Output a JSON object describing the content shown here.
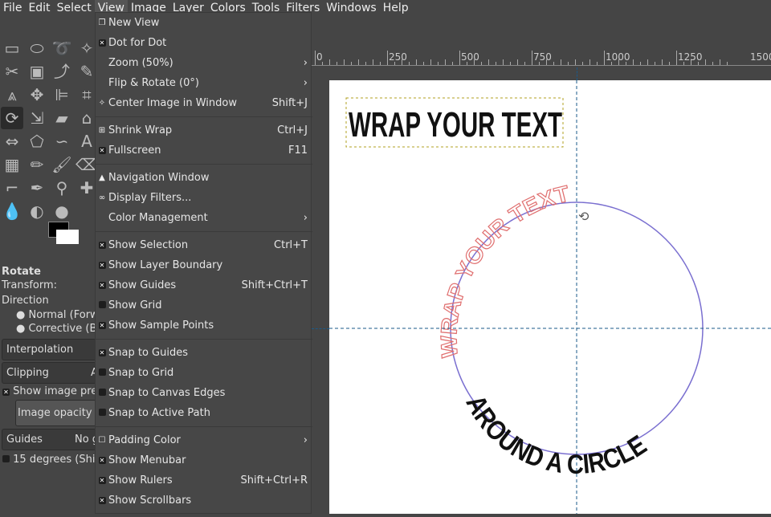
{
  "menubar": [
    "File",
    "Edit",
    "Select",
    "View",
    "Image",
    "Layer",
    "Colors",
    "Tools",
    "Filters",
    "Windows",
    "Help"
  ],
  "view_menu": {
    "groups": [
      [
        {
          "icon": "new-view",
          "label": "New View",
          "shortcut": ""
        },
        {
          "icon": "check",
          "checked": true,
          "label": "Dot for Dot",
          "shortcut": ""
        },
        {
          "icon": "",
          "label": "Zoom (50%)",
          "shortcut": "›"
        },
        {
          "icon": "",
          "label": "Flip & Rotate (0°)",
          "shortcut": "›"
        },
        {
          "icon": "center",
          "label": "Center Image in Window",
          "shortcut": "Shift+J"
        }
      ],
      [
        {
          "icon": "shrink",
          "label": "Shrink Wrap",
          "shortcut": "Ctrl+J"
        },
        {
          "icon": "check",
          "checked": true,
          "label": "Fullscreen",
          "shortcut": "F11"
        }
      ],
      [
        {
          "icon": "nav",
          "label": "Navigation Window",
          "shortcut": ""
        },
        {
          "icon": "glasses",
          "label": "Display Filters...",
          "shortcut": ""
        },
        {
          "icon": "",
          "label": "Color Management",
          "shortcut": "›"
        }
      ],
      [
        {
          "icon": "check",
          "checked": true,
          "label": "Show Selection",
          "shortcut": "Ctrl+T"
        },
        {
          "icon": "check",
          "checked": true,
          "label": "Show Layer Boundary",
          "shortcut": ""
        },
        {
          "icon": "check",
          "checked": true,
          "label": "Show Guides",
          "shortcut": "Shift+Ctrl+T"
        },
        {
          "icon": "check",
          "checked": false,
          "label": "Show Grid",
          "shortcut": ""
        },
        {
          "icon": "check",
          "checked": true,
          "label": "Show Sample Points",
          "shortcut": ""
        }
      ],
      [
        {
          "icon": "check",
          "checked": true,
          "label": "Snap to Guides",
          "shortcut": ""
        },
        {
          "icon": "check",
          "checked": false,
          "label": "Snap to Grid",
          "shortcut": ""
        },
        {
          "icon": "check",
          "checked": false,
          "label": "Snap to Canvas Edges",
          "shortcut": ""
        },
        {
          "icon": "check",
          "checked": false,
          "label": "Snap to Active Path",
          "shortcut": ""
        }
      ],
      [
        {
          "icon": "square",
          "label": "Padding Color",
          "shortcut": "›"
        },
        {
          "icon": "check",
          "checked": true,
          "label": "Show Menubar",
          "shortcut": ""
        },
        {
          "icon": "check",
          "checked": true,
          "label": "Show Rulers",
          "shortcut": "Shift+Ctrl+R"
        },
        {
          "icon": "check",
          "checked": true,
          "label": "Show Scrollbars",
          "shortcut": ""
        }
      ]
    ]
  },
  "tool_options": {
    "title": "Rotate",
    "transform_label": "Transform:",
    "direction_label": "Direction",
    "direction_normal": "Normal (Forw",
    "direction_corrective": "Corrective (B",
    "interpolation": "Interpolation",
    "clipping": "Clipping",
    "clipping_value": "A",
    "show_preview": "Show image pre",
    "image_opacity": "Image opacity",
    "guides": "Guides",
    "guides_value": "No g",
    "degrees": "15 degrees (Shi"
  },
  "ruler": [
    "0",
    "250",
    "500",
    "750",
    "1000",
    "1250",
    "1500"
  ],
  "canvas": {
    "title_text": "WRAP YOUR TEXT",
    "arc_top_text": "WRAP YOUR TEXT",
    "arc_bottom_text": "AROUND A CIRCLE",
    "circle_color": "#7a6fd0",
    "arc_top_color": "#e07070"
  }
}
